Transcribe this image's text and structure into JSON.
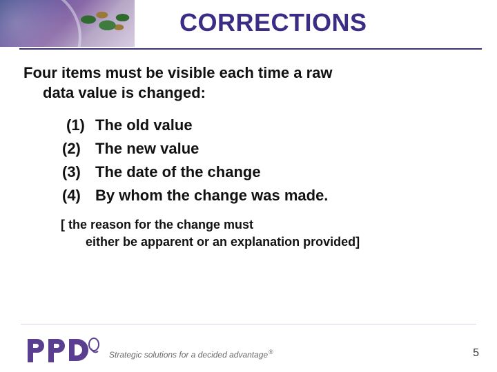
{
  "title": "CORRECTIONS",
  "lead_line1": "Four items must be visible each time a raw",
  "lead_line2": "data value is changed:",
  "items": [
    {
      "num": "(1)",
      "text": "The old value"
    },
    {
      "num": "(2)",
      "text": "The new value"
    },
    {
      "num": "(3)",
      "text": "The date of the change"
    },
    {
      "num": "(4)",
      "text": "By whom the change was made."
    }
  ],
  "note_line1": "[ the reason for the change must",
  "note_line2": "either be apparent or an explanation provided]",
  "footer": {
    "logo_text": "PPD",
    "tagline": "Strategic solutions for a decided advantage",
    "reg": "®",
    "page": "5"
  },
  "colors": {
    "title": "#3b2d86",
    "rule": "#3b3070",
    "logo": "#5a3f90"
  }
}
